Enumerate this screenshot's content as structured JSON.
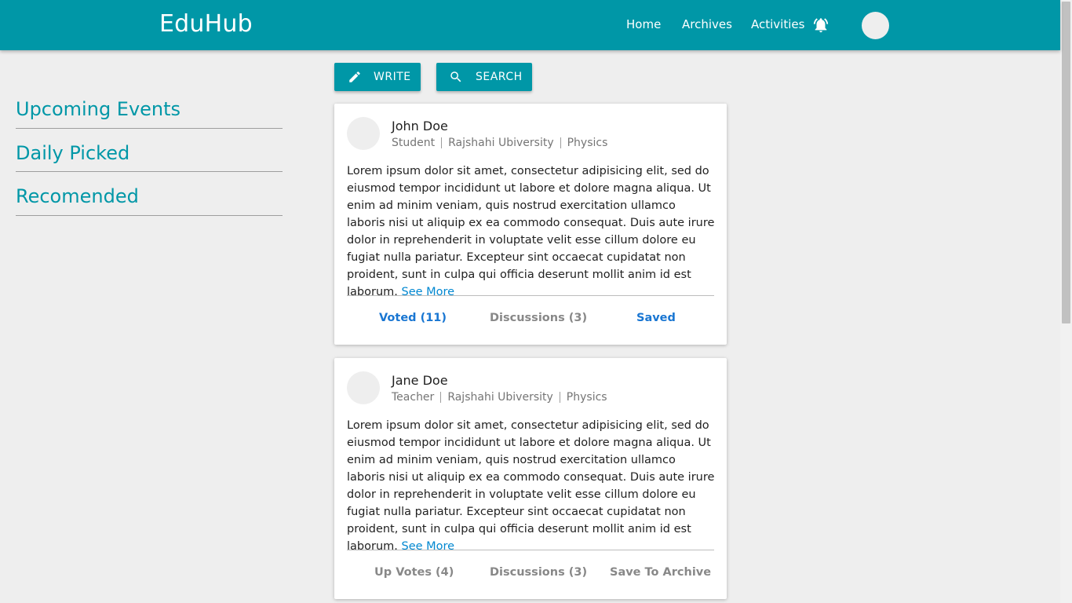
{
  "header": {
    "brand": "EduHub",
    "nav": [
      "Home",
      "Archives",
      "Activities"
    ],
    "icons": [
      "bell-icon",
      "avatar"
    ]
  },
  "sidebar": {
    "items": [
      "Upcoming Events",
      "Daily Picked",
      "Recomended"
    ]
  },
  "toolbar": {
    "write_label": "WRITE",
    "search_label": "SEARCH"
  },
  "posts": [
    {
      "author": "John Doe",
      "role": "Student",
      "institution": "Rajshahi Ubiversity",
      "subject": "Physics",
      "body": "Lorem ipsum dolor sit amet, consectetur adipisicing elit, sed do eiusmod tempor incididunt ut labore et dolore magna aliqua. Ut enim ad minim veniam, quis nostrud exercitation ullamco laboris nisi ut aliquip ex ea commodo consequat. Duis aute irure dolor in reprehenderit in voluptate velit esse cillum dolore eu fugiat nulla pariatur. Excepteur sint occaecat cupidatat non proident, sunt in culpa qui officia deserunt mollit anim id est laborum.",
      "see_more": "See More",
      "vote_label": "Voted (11)",
      "discussion_label": "Discussions (3)",
      "save_label": "Saved"
    },
    {
      "author": "Jane Doe",
      "role": "Teacher",
      "institution": "Rajshahi Ubiversity",
      "subject": "Physics",
      "body": "Lorem ipsum dolor sit amet, consectetur adipisicing elit, sed do eiusmod tempor incididunt ut labore et dolore magna aliqua. Ut enim ad minim veniam, quis nostrud exercitation ullamco laboris nisi ut aliquip ex ea commodo consequat. Duis aute irure dolor in reprehenderit in voluptate velit esse cillum dolore eu fugiat nulla pariatur. Excepteur sint occaecat cupidatat non proident, sunt in culpa qui officia deserunt mollit anim id est laborum.",
      "see_more": "See More",
      "vote_label": "Up Votes (4)",
      "discussion_label": "Discussions (3)",
      "save_label": "Save To Archive"
    }
  ],
  "colors": {
    "primary": "#0097a7",
    "link": "#0288d1",
    "active_action": "#1976d2",
    "inactive_action": "#888888",
    "background": "#eeeeee"
  }
}
